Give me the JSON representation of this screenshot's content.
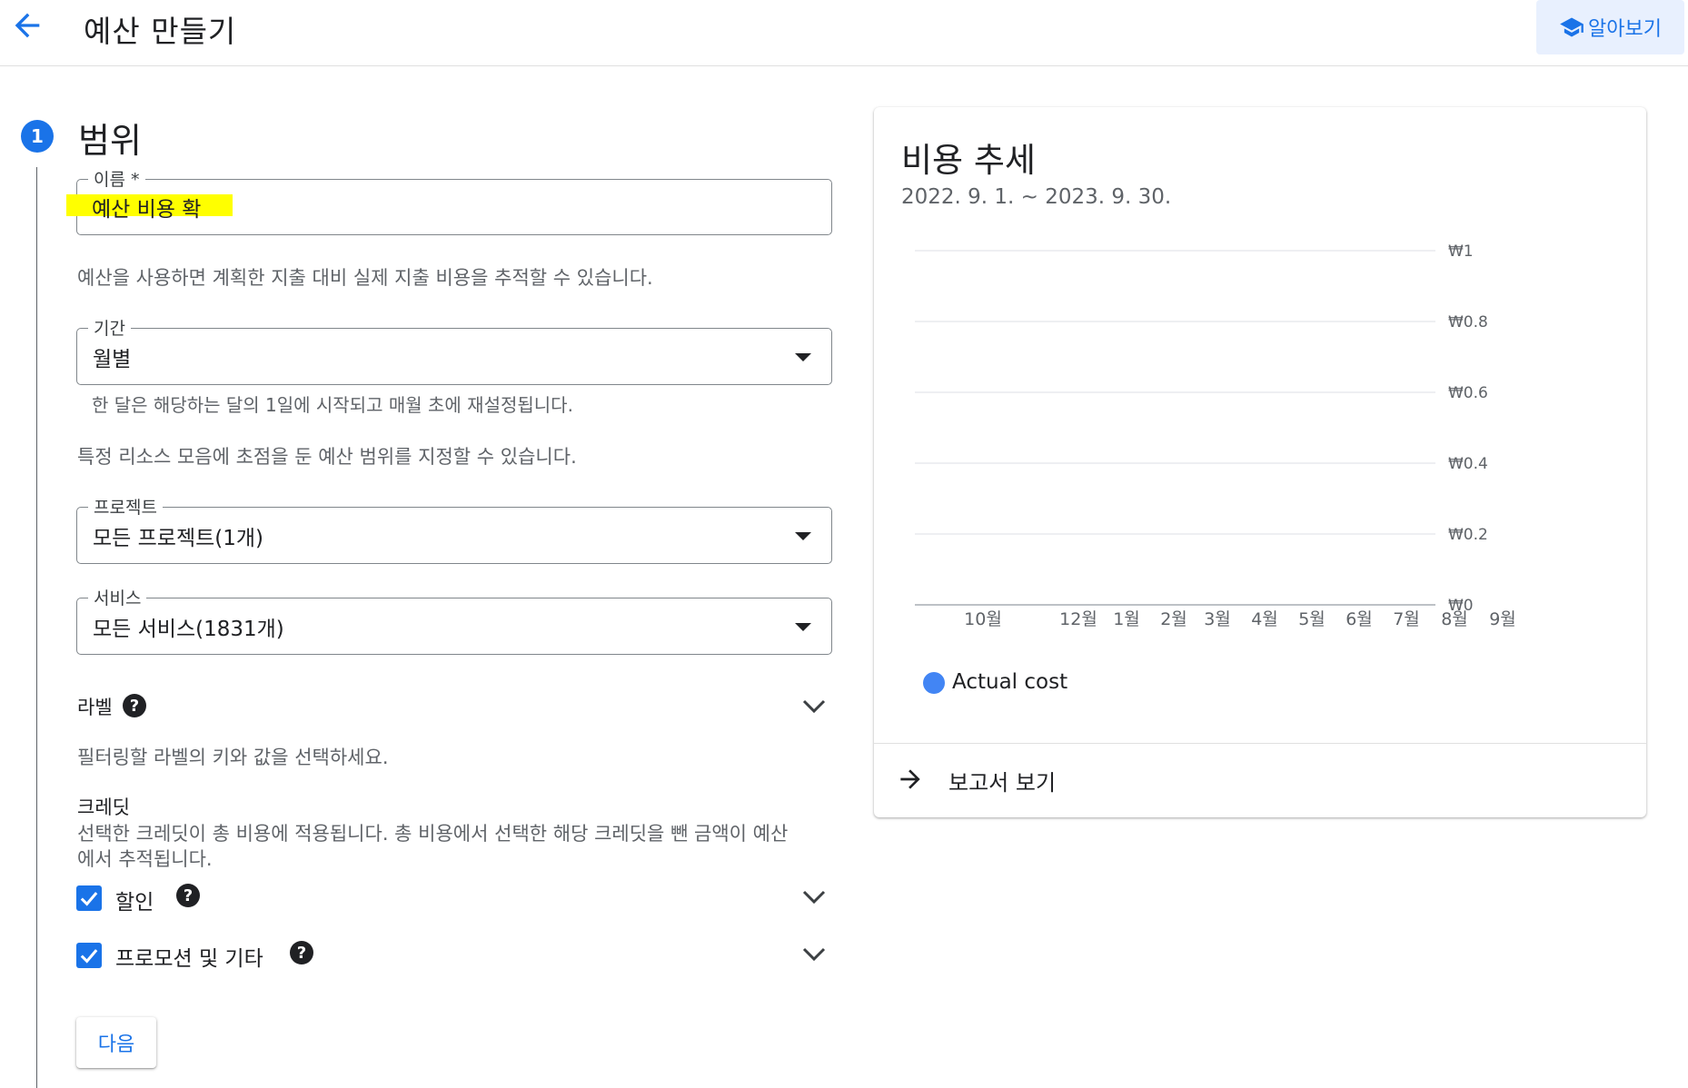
{
  "header": {
    "title": "예산 만들기",
    "learn_label": "알아보기"
  },
  "step": {
    "number": "1",
    "title": "범위"
  },
  "form": {
    "name": {
      "label": "이름 *",
      "value": "예산 비용 확"
    },
    "budget_desc": "예산을 사용하면 계획한 지출 대비 실제 지출 비용을 추적할 수 있습니다.",
    "period": {
      "label": "기간",
      "value": "월별",
      "hint": "한 달은 해당하는 달의 1일에 시작되고 매월 초에 재설정됩니다."
    },
    "scope_desc": "특정 리소스 모음에 초점을 둔 예산 범위를 지정할 수 있습니다.",
    "project": {
      "label": "프로젝트",
      "value": "모든 프로젝트(1개)"
    },
    "service": {
      "label": "서비스",
      "value": "모든 서비스(1831개)"
    },
    "labels": {
      "title": "라벨",
      "desc": "필터링할 라벨의 키와 값을 선택하세요."
    },
    "credits": {
      "title": "크레딧",
      "desc_line1": "선택한 크레딧이 총 비용에 적용됩니다. 총 비용에서 선택한 해당 크레딧을 뺀 금액이 예산",
      "desc_line2": "에서 추적됩니다.",
      "items": [
        {
          "label": "할인",
          "checked": true
        },
        {
          "label": "프로모션 및 기타",
          "checked": true
        }
      ]
    },
    "next_label": "다음"
  },
  "trend_card": {
    "title": "비용 추세",
    "date_range": "2022. 9. 1. ~ 2023. 9. 30.",
    "report_label": "보고서 보기"
  },
  "chart_data": {
    "type": "line",
    "x": [
      "10월",
      "12월",
      "1월",
      "2월",
      "3월",
      "4월",
      "5월",
      "6월",
      "7월",
      "8월",
      "9월"
    ],
    "y_ticks": [
      "₩1",
      "₩0.8",
      "₩0.6",
      "₩0.4",
      "₩0.2",
      "₩0"
    ],
    "ylim": [
      0,
      1
    ],
    "series": [
      {
        "name": "Actual cost",
        "values": [],
        "color": "#4285f4"
      }
    ],
    "grid": true
  },
  "colors": {
    "accent": "#1a73e8",
    "series": "#4285f4",
    "highlight": "#ffff00"
  }
}
